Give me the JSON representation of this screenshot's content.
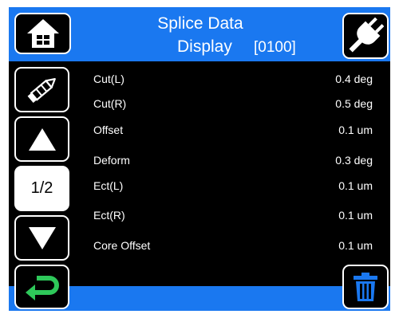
{
  "header": {
    "title_line1": "Splice Data",
    "title_line2": "Display",
    "code": "[0100]"
  },
  "rows": [
    {
      "label": "Cut(L)",
      "value": "0.4 deg"
    },
    {
      "label": "Cut(R)",
      "value": "0.5 deg"
    },
    {
      "label": "Offset",
      "value": "0.1 um"
    },
    {
      "label": "Deform",
      "value": "0.3 deg"
    },
    {
      "label": "Ect(L)",
      "value": "0.1 um"
    },
    {
      "label": "Ect(R)",
      "value": "0.1 um"
    },
    {
      "label": "Core Offset",
      "value": "0.1 um"
    }
  ],
  "pager": {
    "indicator": "1/2"
  },
  "icons": {
    "home": "home-icon",
    "plug": "plug-icon",
    "edit": "pencil-icon",
    "up": "arrow-up-icon",
    "down": "arrow-down-icon",
    "back": "return-arrow-icon",
    "delete": "trash-icon"
  },
  "colors": {
    "accent_blue": "#1a78f0",
    "return_green": "#2ec85a",
    "background": "#000000",
    "text": "#ffffff"
  }
}
